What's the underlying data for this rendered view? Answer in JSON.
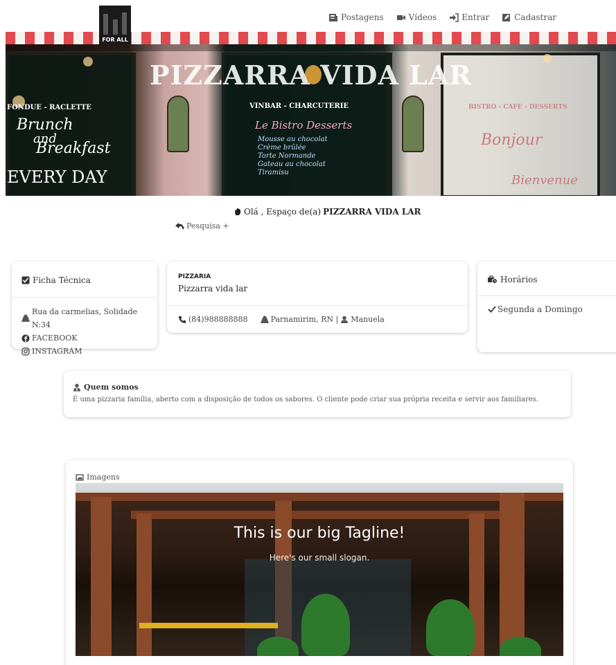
{
  "navbar": {
    "logo_text": "FOR ALL",
    "links": [
      {
        "label": "Postagens",
        "icon": "newspaper-icon"
      },
      {
        "label": "Vídeos",
        "icon": "video-camera-icon"
      },
      {
        "label": "Entrar",
        "icon": "sign-in-icon"
      },
      {
        "label": "Cadastrar",
        "icon": "edit-square-icon"
      }
    ]
  },
  "hero": {
    "title": "PIZZARRA VIDA LAR"
  },
  "greeting": {
    "prefix": "Olá , Espaço de(a)",
    "name": "PIZZARRA VIDA LAR",
    "search_label": "Pesquisa +"
  },
  "ficha": {
    "title": "Ficha Técnica",
    "address": "Rua da carmelias, Solidade N:34",
    "facebook": "FACEBOOK",
    "instagram": "INSTAGRAM"
  },
  "business": {
    "type": "PIZZARIA",
    "name": "Pizzarra vida lar",
    "phone": "(84)988888888",
    "city": "Parnamirim, RN |",
    "owner": "Manuela"
  },
  "horarios": {
    "title": "Horários",
    "days": "Segunda a Domingo"
  },
  "quem_somos": {
    "title": "Quem somos",
    "text": "É uma pizzaria família, aberto com a disposição de todos os sabores. O cliente pode criar sua própria receita e servir aos familiares."
  },
  "imagens": {
    "title": "Imagens",
    "tagline": "This is our big Tagline!",
    "slogan": "Here's our small slogan."
  },
  "colors": {
    "awning_red": "#e24a4f",
    "logo_dark": "#1a1a1a"
  }
}
